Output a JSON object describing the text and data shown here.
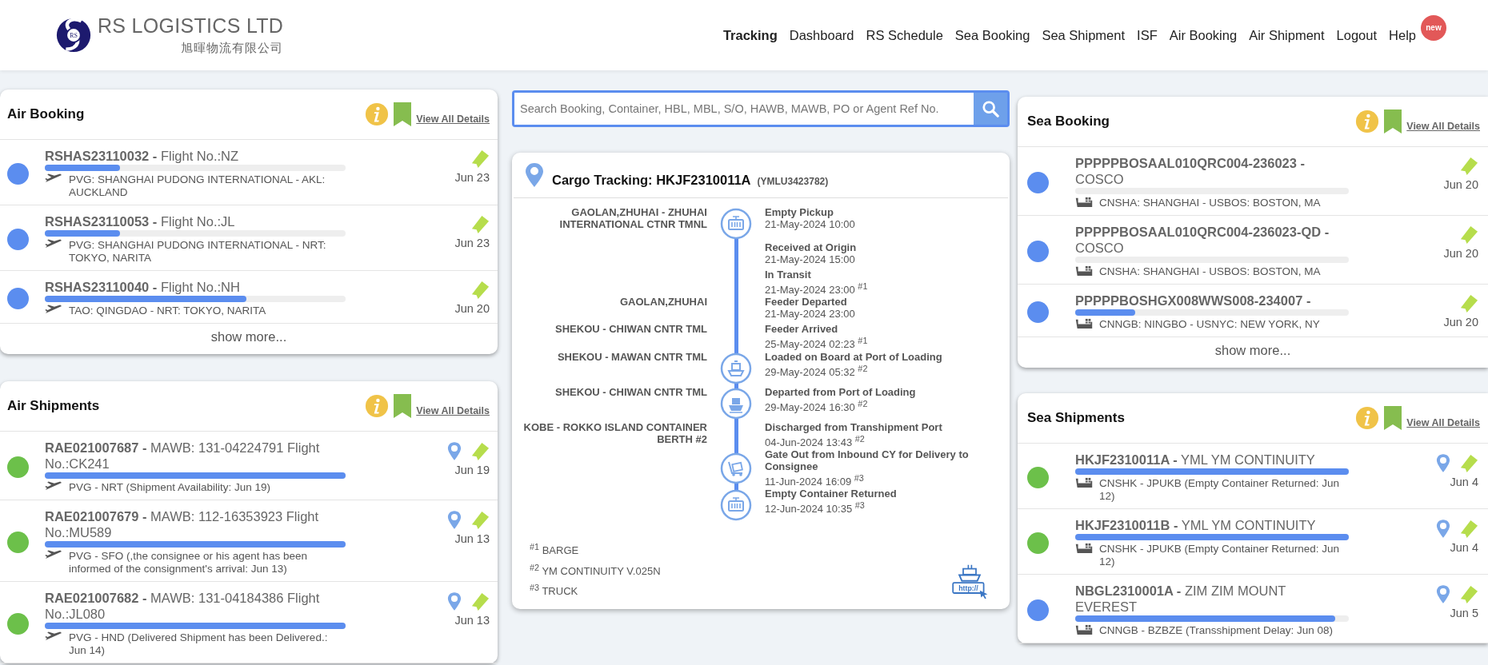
{
  "header": {
    "logo_mark": "RS",
    "company": "RS LOGISTICS LTD",
    "company_chinese": "旭暉物流有限公司",
    "nav": [
      {
        "label": "Tracking",
        "selected": true
      },
      {
        "label": "Dashboard",
        "selected": false
      },
      {
        "label": "RS Schedule",
        "selected": false
      },
      {
        "label": "Sea Booking",
        "selected": false
      },
      {
        "label": "Sea Shipment",
        "selected": false
      },
      {
        "label": "ISF",
        "selected": false
      },
      {
        "label": "Air Booking",
        "selected": false
      },
      {
        "label": "Air Shipment",
        "selected": false
      },
      {
        "label": "Logout",
        "selected": false
      },
      {
        "label": "Help",
        "selected": false
      }
    ],
    "help_badge": "new"
  },
  "left_panels": [
    {
      "title": "Air Booking",
      "kind": "air",
      "link": "View All Details",
      "show_more": "show more...",
      "rows": [
        {
          "text": "**RSHAS23110032 -** Flight No.:NZ",
          "route": "PVG: SHANGHAI PUDONG INTERNATIONAL - AKL: AUCKLAND",
          "date": "Jun 23",
          "level": 0.25,
          "color": "#5b8def",
          "tracking": false
        },
        {
          "text": "**RSHAS23110053 -** Flight No.:JL",
          "route": "PVG: SHANGHAI PUDONG INTERNATIONAL - NRT: TOKYO, NARITA",
          "date": "Jun 23",
          "level": 0.25,
          "color": "#5b8def",
          "tracking": false
        },
        {
          "text": "**RSHAS23110040 -** Flight No.:NH",
          "route": "TAO: QINGDAO - NRT: TOKYO, NARITA",
          "date": "Jun 20",
          "level": 0.67,
          "color": "#5b8def",
          "tracking": false
        }
      ]
    },
    {
      "title": "Air Shipments",
      "kind": "air",
      "link": "View All Details",
      "rows": [
        {
          "text": "**RAE021007687 -** MAWB: 131-04224791 Flight No.:CK241",
          "route": "PVG - NRT (Shipment Availability: Jun 19)",
          "date": "Jun 19",
          "level": 1,
          "color": "#6cc04a",
          "tracking": true
        },
        {
          "text": "**RAE021007679 -** MAWB: 112-16353923 Flight No.:MU589",
          "route": "PVG - SFO (,the consignee or his agent has been informed of the consignment's arrival: Jun 13)",
          "date": "Jun 13",
          "level": 1,
          "color": "#6cc04a",
          "tracking": true
        },
        {
          "text": "**RAE021007682 -** MAWB: 131-04184386 Flight No.:JL080",
          "route": "PVG - HND (Delivered Shipment has been Delivered.: Jun 14)",
          "date": "Jun 13",
          "level": 1,
          "color": "#6cc04a",
          "tracking": true
        }
      ]
    }
  ],
  "search": {
    "placeholder": "Search Booking, Container, HBL, MBL, S/O, HAWB, MAWB, PO or Agent Ref No."
  },
  "tracking": {
    "title": "Cargo Tracking: HKJF2310011A",
    "container": "(YMLU3423782)",
    "events": [
      {
        "location": "GAOLAN,ZHUHAI - ZHUHAI INTERNATIONAL CTNR TMNL",
        "status": "Empty Pickup",
        "time": "21-May-2024 10:00",
        "kind": "container"
      },
      {
        "status": "Received at Origin",
        "time": "21-May-2024 15:00",
        "kind": "line"
      },
      {
        "status": "In Transit",
        "time": "21-May-2024 23:00 $^{#1}$",
        "kind": "line"
      },
      {
        "location": "GAOLAN,ZHUHAI",
        "status": "Feeder Departed",
        "time": "21-May-2024 23:00",
        "kind": "line"
      },
      {
        "location": "SHEKOU - CHIWAN CNTR TML",
        "status": "Feeder Arrived",
        "time": "25-May-2024 02:23 $^{#1}$",
        "kind": "line"
      },
      {
        "location": "SHEKOU - MAWAN CNTR TML",
        "status": "Loaded on Board at Port of Loading",
        "time": "29-May-2024 05:32 $^{#2}$",
        "kind": "loading"
      },
      {
        "location": "SHEKOU - CHIWAN CNTR TML",
        "status": "Departed from Port of Loading",
        "time": "29-May-2024 16:30 $^{#2}$",
        "kind": "ship"
      },
      {
        "location": "KOBE - ROKKO ISLAND CONTAINER BERTH #2",
        "status": "Discharged from Transhipment Port",
        "time": "04-Jun-2024 13:43 $^{#2}$",
        "kind": "line"
      },
      {
        "status": "Gate Out from Inbound CY for Delivery to Consignee",
        "time": "11-Jun-2024 16:09 $^{#3}$",
        "kind": "truck"
      },
      {
        "status": "Empty Container Returned",
        "time": "12-Jun-2024 10:35 $^{#3}$",
        "kind": "container"
      }
    ],
    "footnotes": [
      "$^{#1}$ BARGE",
      "$^{#2}$ YM CONTINUITY V.025N",
      "$^{#3}$ TRUCK"
    ],
    "link_icon_text": "http://"
  },
  "right_panels": [
    {
      "title": "Sea Booking",
      "kind": "sea",
      "link": "View All Details",
      "show_more": "show more...",
      "rows": [
        {
          "text": "**PPPPPBOSAAL010QRC004-236023 -** COSCO",
          "route": "CNSHA: SHANGHAI - USBOS: BOSTON, MA",
          "date": "Jun 20",
          "level": 0,
          "color": "#5b8def",
          "tracking": false
        },
        {
          "text": "**PPPPPBOSAAL010QRC004-236023-QD -** COSCO",
          "route": "CNSHA: SHANGHAI - USBOS: BOSTON, MA",
          "date": "Jun 20",
          "level": 0,
          "color": "#5b8def",
          "tracking": false
        },
        {
          "text": "**PPPPPBOSHGX008WWS008-234007 -**",
          "route": "CNNGB: NINGBO - USNYC: NEW YORK, NY",
          "date": "Jun 20",
          "level": 0.22,
          "color": "#5b8def",
          "tracking": false
        }
      ]
    },
    {
      "title": "Sea Shipments",
      "kind": "sea",
      "link": "View All Details",
      "rows": [
        {
          "text": "**HKJF2310011A -** YML YM CONTINUITY",
          "route": "CNSHK - JPUKB (Empty Container Returned: Jun 12)",
          "date": "Jun 4",
          "level": 1,
          "color": "#6cc04a",
          "tracking": true
        },
        {
          "text": "**HKJF2310011B -** YML YM CONTINUITY",
          "route": "CNSHK - JPUKB (Empty Container Returned: Jun 12)",
          "date": "Jun 4",
          "level": 1,
          "color": "#6cc04a",
          "tracking": true
        },
        {
          "text": "**NBGL2310001A -** ZIM ZIM MOUNT EVEREST",
          "route": "CNNGB - BZBZE (Transshipment Delay: Jun 08)",
          "date": "Jun 5",
          "level": 0.95,
          "color": "#5b8def",
          "tracking": true
        }
      ]
    }
  ]
}
